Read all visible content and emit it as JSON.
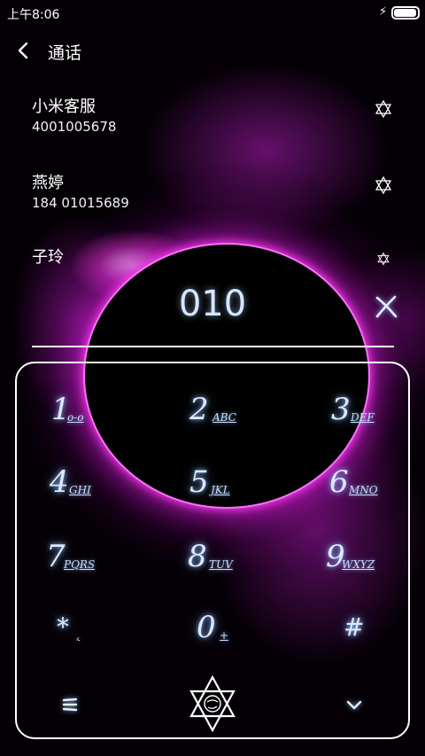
{
  "status_bar": {
    "time": "上午8:06",
    "battery_level": 0.95,
    "charging_icon": "charging-bolt-icon",
    "battery_icon": "battery-icon"
  },
  "header": {
    "back_icon": "back-chevron-icon",
    "title": "通话"
  },
  "contacts": [
    {
      "name": "小米客服",
      "number": "4001005678",
      "icon": "hexagram-icon"
    },
    {
      "name": "燕婷",
      "number": "184 01015689",
      "icon": "hexagram-icon"
    },
    {
      "name": "子玲",
      "number": "",
      "icon": "hexagram-icon"
    }
  ],
  "dialer": {
    "input_value": "010",
    "clear_icon": "clear-x-icon",
    "keys": [
      {
        "digit": "1",
        "letters": "o-o"
      },
      {
        "digit": "2",
        "letters": "ABC"
      },
      {
        "digit": "3",
        "letters": "DEF"
      },
      {
        "digit": "4",
        "letters": "GHI"
      },
      {
        "digit": "5",
        "letters": "JKL"
      },
      {
        "digit": "6",
        "letters": "MNO"
      },
      {
        "digit": "7",
        "letters": "PQRS"
      },
      {
        "digit": "8",
        "letters": "TUV"
      },
      {
        "digit": "9",
        "letters": "WXYZ"
      },
      {
        "digit": "*",
        "letters": ","
      },
      {
        "digit": "0",
        "letters": "+"
      },
      {
        "digit": "#",
        "letters": ""
      }
    ],
    "bottom_bar": {
      "menu_icon": "menu-icon",
      "dial_icon": "hexagram-dial-icon",
      "collapse_icon": "chevron-down-icon"
    }
  },
  "colors": {
    "glow": "#cfe2ff",
    "accent_magenta": "#ff3cf0",
    "background": "#050006"
  }
}
